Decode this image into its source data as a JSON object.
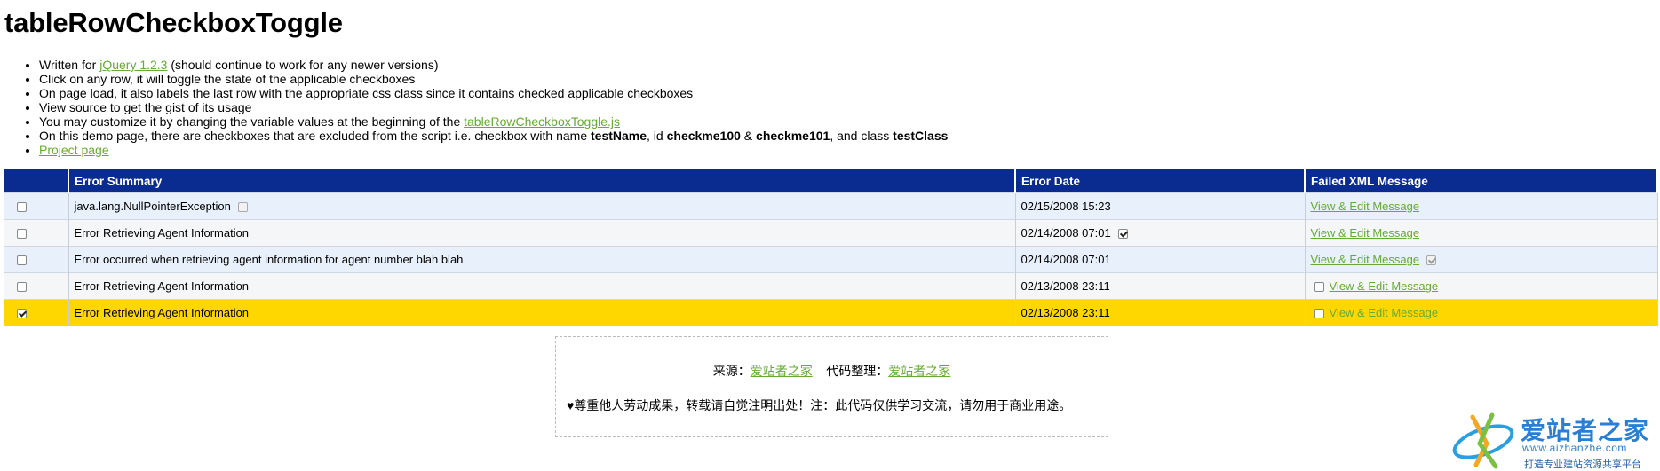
{
  "page": {
    "title": "tableRowCheckboxToggle"
  },
  "notes": {
    "item1": {
      "pre": "Written for ",
      "link": "jQuery 1.2.3",
      "post": " (should continue to work for any newer versions)"
    },
    "item2": "Click on any row, it will toggle the state of the applicable checkboxes",
    "item3": "On page load, it also labels the last row with the appropriate css class since it contains checked applicable checkboxes",
    "item4": "View source to get the gist of its usage",
    "item5": {
      "pre": "You may customize it by changing the variable values at the beginning of the ",
      "link": "tableRowCheckboxToggle.js"
    },
    "item6": {
      "pre": "On this demo page, there are checkboxes that are excluded from the script i.e. checkbox with name ",
      "b1": "testName",
      "mid1": ", id ",
      "b2": "checkme100",
      "mid2": " & ",
      "b3": "checkme101",
      "mid3": ", and class ",
      "b4": "testClass"
    },
    "item7": {
      "link": "Project page"
    }
  },
  "table": {
    "headers": [
      "",
      "Error Summary",
      "Error Date",
      "Failed XML Message"
    ],
    "link_label": "View & Edit Message",
    "rows": [
      {
        "checked": false,
        "summary": "java.lang.NullPointerException",
        "date": "02/15/2008 15:23",
        "selected": false
      },
      {
        "checked": false,
        "summary": "Error Retrieving Agent Information",
        "date": "02/14/2008 07:01",
        "selected": false
      },
      {
        "checked": false,
        "summary": "Error occurred when retrieving agent information for agent number blah blah",
        "date": "02/14/2008 07:01",
        "selected": false
      },
      {
        "checked": false,
        "summary": "Error Retrieving Agent Information",
        "date": "02/13/2008 23:11",
        "selected": false
      },
      {
        "checked": true,
        "summary": "Error Retrieving Agent Information",
        "date": "02/13/2008 23:11",
        "selected": true
      }
    ]
  },
  "footer": {
    "source_label": "来源：",
    "source_link": "爱站者之家",
    "organizer_label": "代码整理：",
    "organizer_link": "爱站者之家",
    "notice": "♥尊重他人劳动成果，转载请自觉注明出处！注：此代码仅供学习交流，请勿用于商业用途。"
  },
  "logo": {
    "brand": "爱站者之家",
    "domain": "www.aizhanzhe.com",
    "slogan": "打造专业建站资源共享平台"
  },
  "colors": {
    "header_bg": "#0a2b8f",
    "selected_row": "#ffd700",
    "link": "#66aa33",
    "logo_blue": "#2a7fd4"
  }
}
